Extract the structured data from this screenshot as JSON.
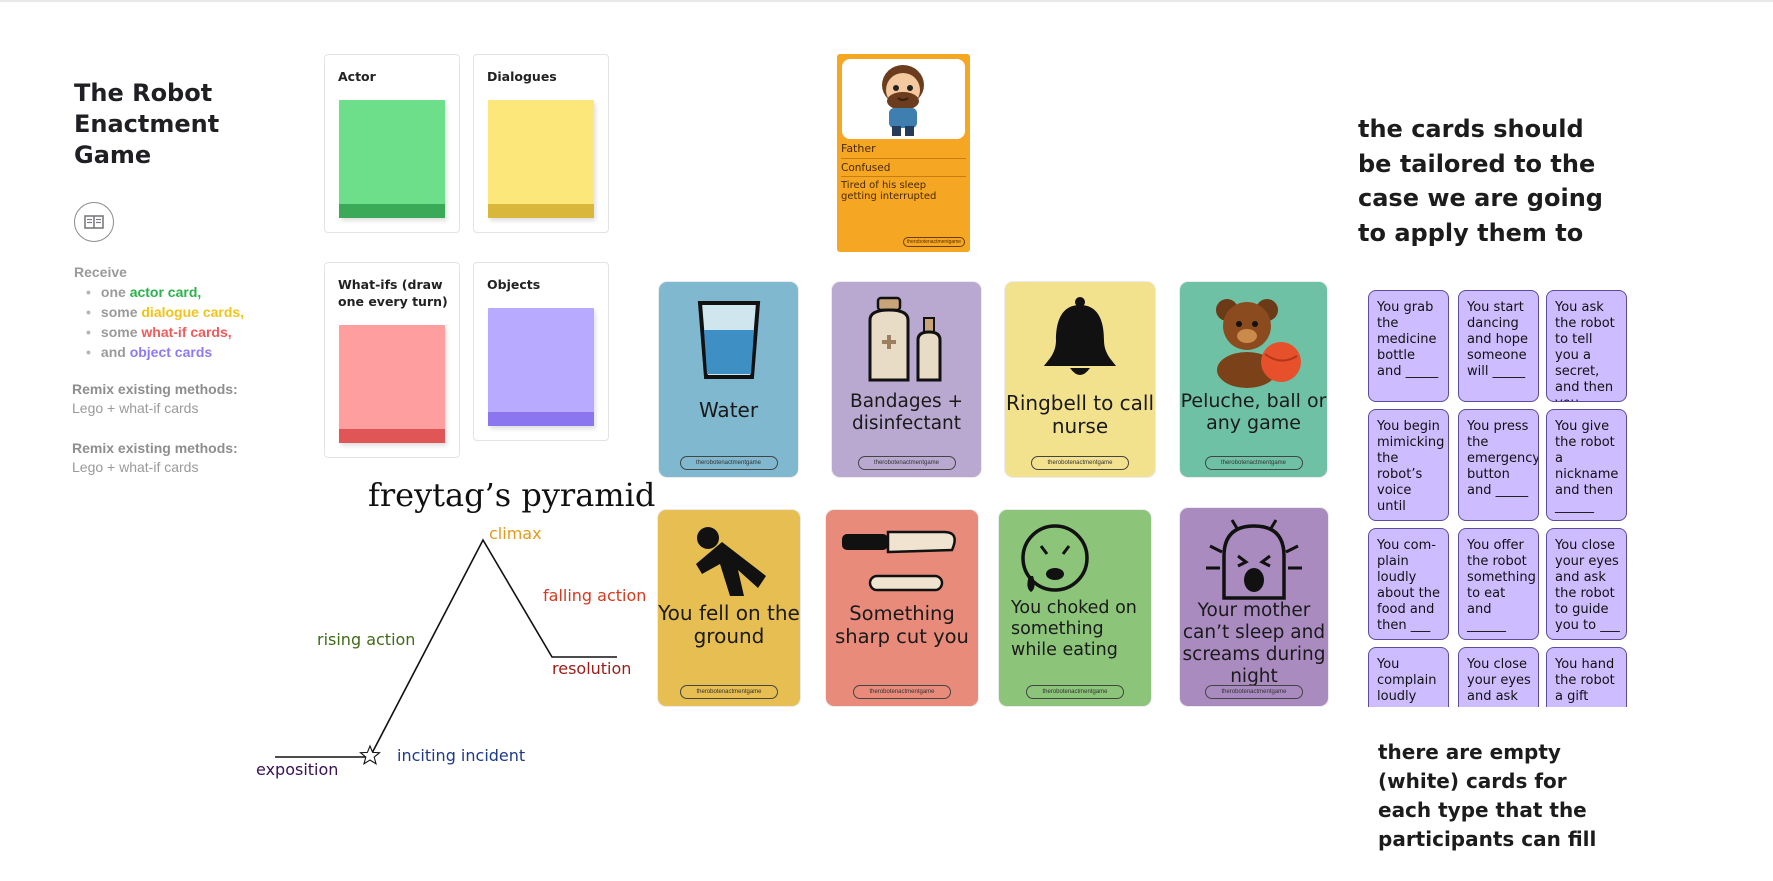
{
  "board": {
    "title": "The Robot Enactment Game",
    "receive_label": "Receive",
    "receive_items": [
      {
        "prefix": "one ",
        "highlight": "actor card,",
        "color": "#2bb24c"
      },
      {
        "prefix": "some ",
        "highlight": "dialogue cards,",
        "color": "#f2c318"
      },
      {
        "prefix": "some ",
        "highlight": "what-if cards,",
        "color": "#ef5a5a"
      },
      {
        "prefix": "and ",
        "highlight": "object cards",
        "color": "#8c7bf0"
      }
    ],
    "remix": [
      {
        "heading": "Remix existing methods:",
        "text": "Lego + what-if cards"
      },
      {
        "heading": "Remix existing methods:",
        "text": "Lego + what-if cards"
      }
    ],
    "book_icon": "book-icon"
  },
  "stickies": [
    {
      "label": "Actor",
      "color": "#6ddf8a",
      "band": "#3aaa58"
    },
    {
      "label": "Dialogues",
      "color": "#fbe77a",
      "band": "#d8b73a"
    },
    {
      "label": "What-ifs (draw one every turn)",
      "color": "#ff9e9e",
      "band": "#e05555"
    },
    {
      "label": "Objects",
      "color": "#b7aaff",
      "band": "#8c76f0"
    }
  ],
  "pyramid": {
    "title": "freytag’s pyramid",
    "climax": "climax",
    "rising": "rising action",
    "falling": "falling action",
    "resolution": "resolution",
    "inciting": "inciting incident",
    "exposition": "exposition",
    "colors": {
      "climax": "#e39a18",
      "rising": "#3f6a17",
      "falling": "#d43b1e",
      "resolution": "#9b1c16",
      "inciting": "#1f3a87",
      "exposition": "#3a1252"
    }
  },
  "actor_card": {
    "role": "Father",
    "mood": "Confused",
    "desc": "Tired of his sleep getting interrupted",
    "footer": "therobotenactmentgame"
  },
  "object_cards": [
    {
      "text": "Water",
      "color": "#7fb8cf",
      "icon": "glass-of-water-icon"
    },
    {
      "text": "Bandages + disinfectant",
      "color": "#b9a8cf",
      "icon": "medicine-bottles-icon"
    },
    {
      "text": "Ringbell to call nurse",
      "color": "#f3e28d",
      "icon": "bell-icon"
    },
    {
      "text": "Peluche, ball or any game",
      "color": "#6fc1a6",
      "icon": "teddy-bear-icon"
    }
  ],
  "whatif_cards": [
    {
      "text": "You fell on the ground",
      "color": "#e6be52",
      "icon": "falling-person-icon"
    },
    {
      "text": "Something sharp cut you",
      "color": "#e88b7b",
      "icon": "knife-icon"
    },
    {
      "text": "You choked on something while eating",
      "color": "#8cc47a",
      "icon": "choking-face-icon"
    },
    {
      "text": "Your mother can’t sleep and screams during night",
      "color": "#a98bc0",
      "icon": "screaming-face-icon"
    }
  ],
  "card_footer": "therobotenactmentgame",
  "notes": {
    "tailored": "the cards should be tailored to the case we are going to apply them to",
    "empty": "there are empty (white) cards for each type that the participants can fill"
  },
  "prompt_cards": [
    "You grab the medicine bottle and _____",
    "You start dancing and hope someone will _____",
    "You ask the robot to tell you a secret, and then you _____",
    "You begin mimicking the robot’s voice until ______",
    "You press the emergency button and _____",
    "You give the robot a nickname and then ______",
    "You com-plain loudly about the food and then ___",
    "You offer the robot something to eat and ______",
    "You close your eyes and ask the robot to guide you to ___",
    "You complain loudly",
    "You close your eyes and ask",
    "You hand the robot a gift"
  ]
}
